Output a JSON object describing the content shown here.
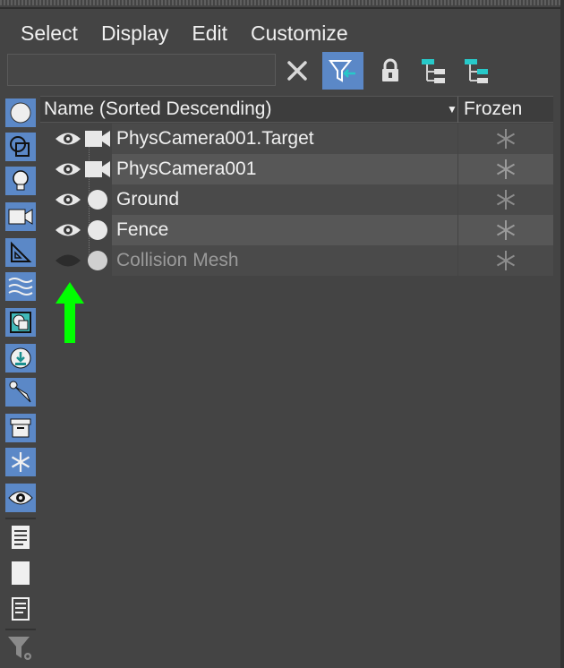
{
  "menubar": {
    "items": [
      "Select",
      "Display",
      "Edit",
      "Customize"
    ]
  },
  "toolbar": {
    "search_value": "",
    "search_placeholder": ""
  },
  "table": {
    "header_name": "Name (Sorted Descending)",
    "header_sort_glyph": "▼",
    "header_frozen": "Frozen",
    "rows": [
      {
        "label": "PhysCamera001.Target",
        "type": "camera",
        "visible": true,
        "frozen": false
      },
      {
        "label": "PhysCamera001",
        "type": "camera",
        "visible": true,
        "frozen": false
      },
      {
        "label": "Ground",
        "type": "geometry",
        "visible": true,
        "frozen": false
      },
      {
        "label": "Fence",
        "type": "geometry",
        "visible": true,
        "frozen": false
      },
      {
        "label": "Collision Mesh",
        "type": "geometry",
        "visible": false,
        "frozen": false
      }
    ]
  },
  "colors": {
    "background": "#444444",
    "accent": "#5b88c7",
    "annotation_arrow": "#00ff00",
    "hidden_text": "#9a9a9a"
  },
  "icons": {
    "sidebar": [
      "geometry-filter-icon",
      "shapes-filter-icon",
      "lights-filter-icon",
      "cameras-filter-icon",
      "helpers-filter-icon",
      "spacewarps-filter-icon",
      "groups-filter-icon",
      "xref-filter-icon",
      "bones-filter-icon",
      "containers-filter-icon",
      "frozen-filter-icon",
      "hidden-filter-icon",
      "select-all-icon",
      "select-none-icon",
      "invert-selection-icon",
      "filter-settings-icon"
    ]
  }
}
